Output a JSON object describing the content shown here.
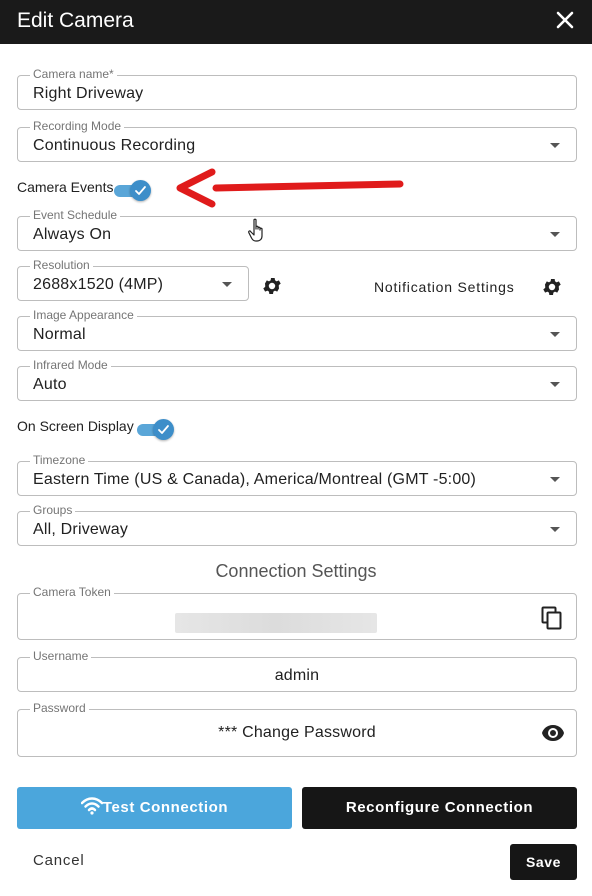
{
  "dialog": {
    "title": "Edit Camera",
    "close_icon": "close-icon"
  },
  "fields": {
    "camera_name": {
      "label": "Camera name*",
      "value": "Right Driveway"
    },
    "recording_mode": {
      "label": "Recording Mode",
      "value": "Continuous Recording"
    },
    "event_schedule": {
      "label": "Event Schedule",
      "value": "Always On"
    },
    "resolution": {
      "label": "Resolution",
      "value": "2688x1520 (4MP)"
    },
    "image_appearance": {
      "label": "Image Appearance",
      "value": "Normal"
    },
    "infrared_mode": {
      "label": "Infrared Mode",
      "value": "Auto"
    },
    "timezone": {
      "label": "Timezone",
      "value": "Eastern Time (US & Canada), America/Montreal (GMT -5:00)"
    },
    "groups": {
      "label": "Groups",
      "value": "All, Driveway"
    },
    "camera_token": {
      "label": "Camera Token",
      "value": ""
    },
    "username": {
      "label": "Username",
      "value": "admin"
    },
    "password": {
      "label": "Password",
      "value": "*** Change Password"
    }
  },
  "toggles": {
    "camera_events": {
      "label": "Camera Events",
      "on": true
    },
    "on_screen_display": {
      "label": "On Screen Display",
      "on": true
    }
  },
  "notification_settings": {
    "label": "Notification Settings"
  },
  "connection": {
    "section_title": "Connection Settings",
    "test_label": "Test Connection",
    "reconfigure_label": "Reconfigure Connection"
  },
  "footer": {
    "cancel_label": "Cancel",
    "save_label": "Save"
  },
  "colors": {
    "accent": "#4ba6dc",
    "toggle": "#3d8ec9",
    "dark": "#161616",
    "annotation_arrow": "#e01b1b"
  },
  "icons": [
    "close-icon",
    "settings-gear-icon",
    "copy-icon",
    "eye-icon",
    "wifi-icon",
    "check-icon",
    "dropdown-caret-icon",
    "hand-pointer-icon",
    "red-arrow-annotation"
  ]
}
